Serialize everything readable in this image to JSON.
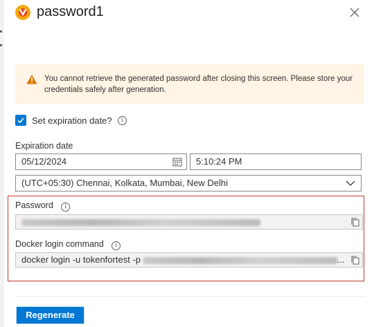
{
  "header": {
    "title": "password1",
    "app_icon": "container-registry-icon"
  },
  "warning": {
    "text": "You cannot retrieve the generated password after closing this screen. Please store your credentials safely after generation."
  },
  "expiration": {
    "checkbox_label": "Set expiration date?",
    "checked": true,
    "date_label": "Expiration date",
    "date_value": "05/12/2024",
    "time_value": "5:10:24 PM",
    "timezone_value": "(UTC+05:30) Chennai, Kolkata, Mumbai, New Delhi"
  },
  "password": {
    "label": "Password"
  },
  "docker": {
    "label": "Docker login command",
    "command_prefix": "docker login -u tokenfortest -p",
    "ellipsis": "..."
  },
  "actions": {
    "regenerate_label": "Regenerate"
  },
  "colors": {
    "accent": "#0078d4",
    "warning_bg": "#fff4e5",
    "highlight_border": "#c0392b"
  }
}
